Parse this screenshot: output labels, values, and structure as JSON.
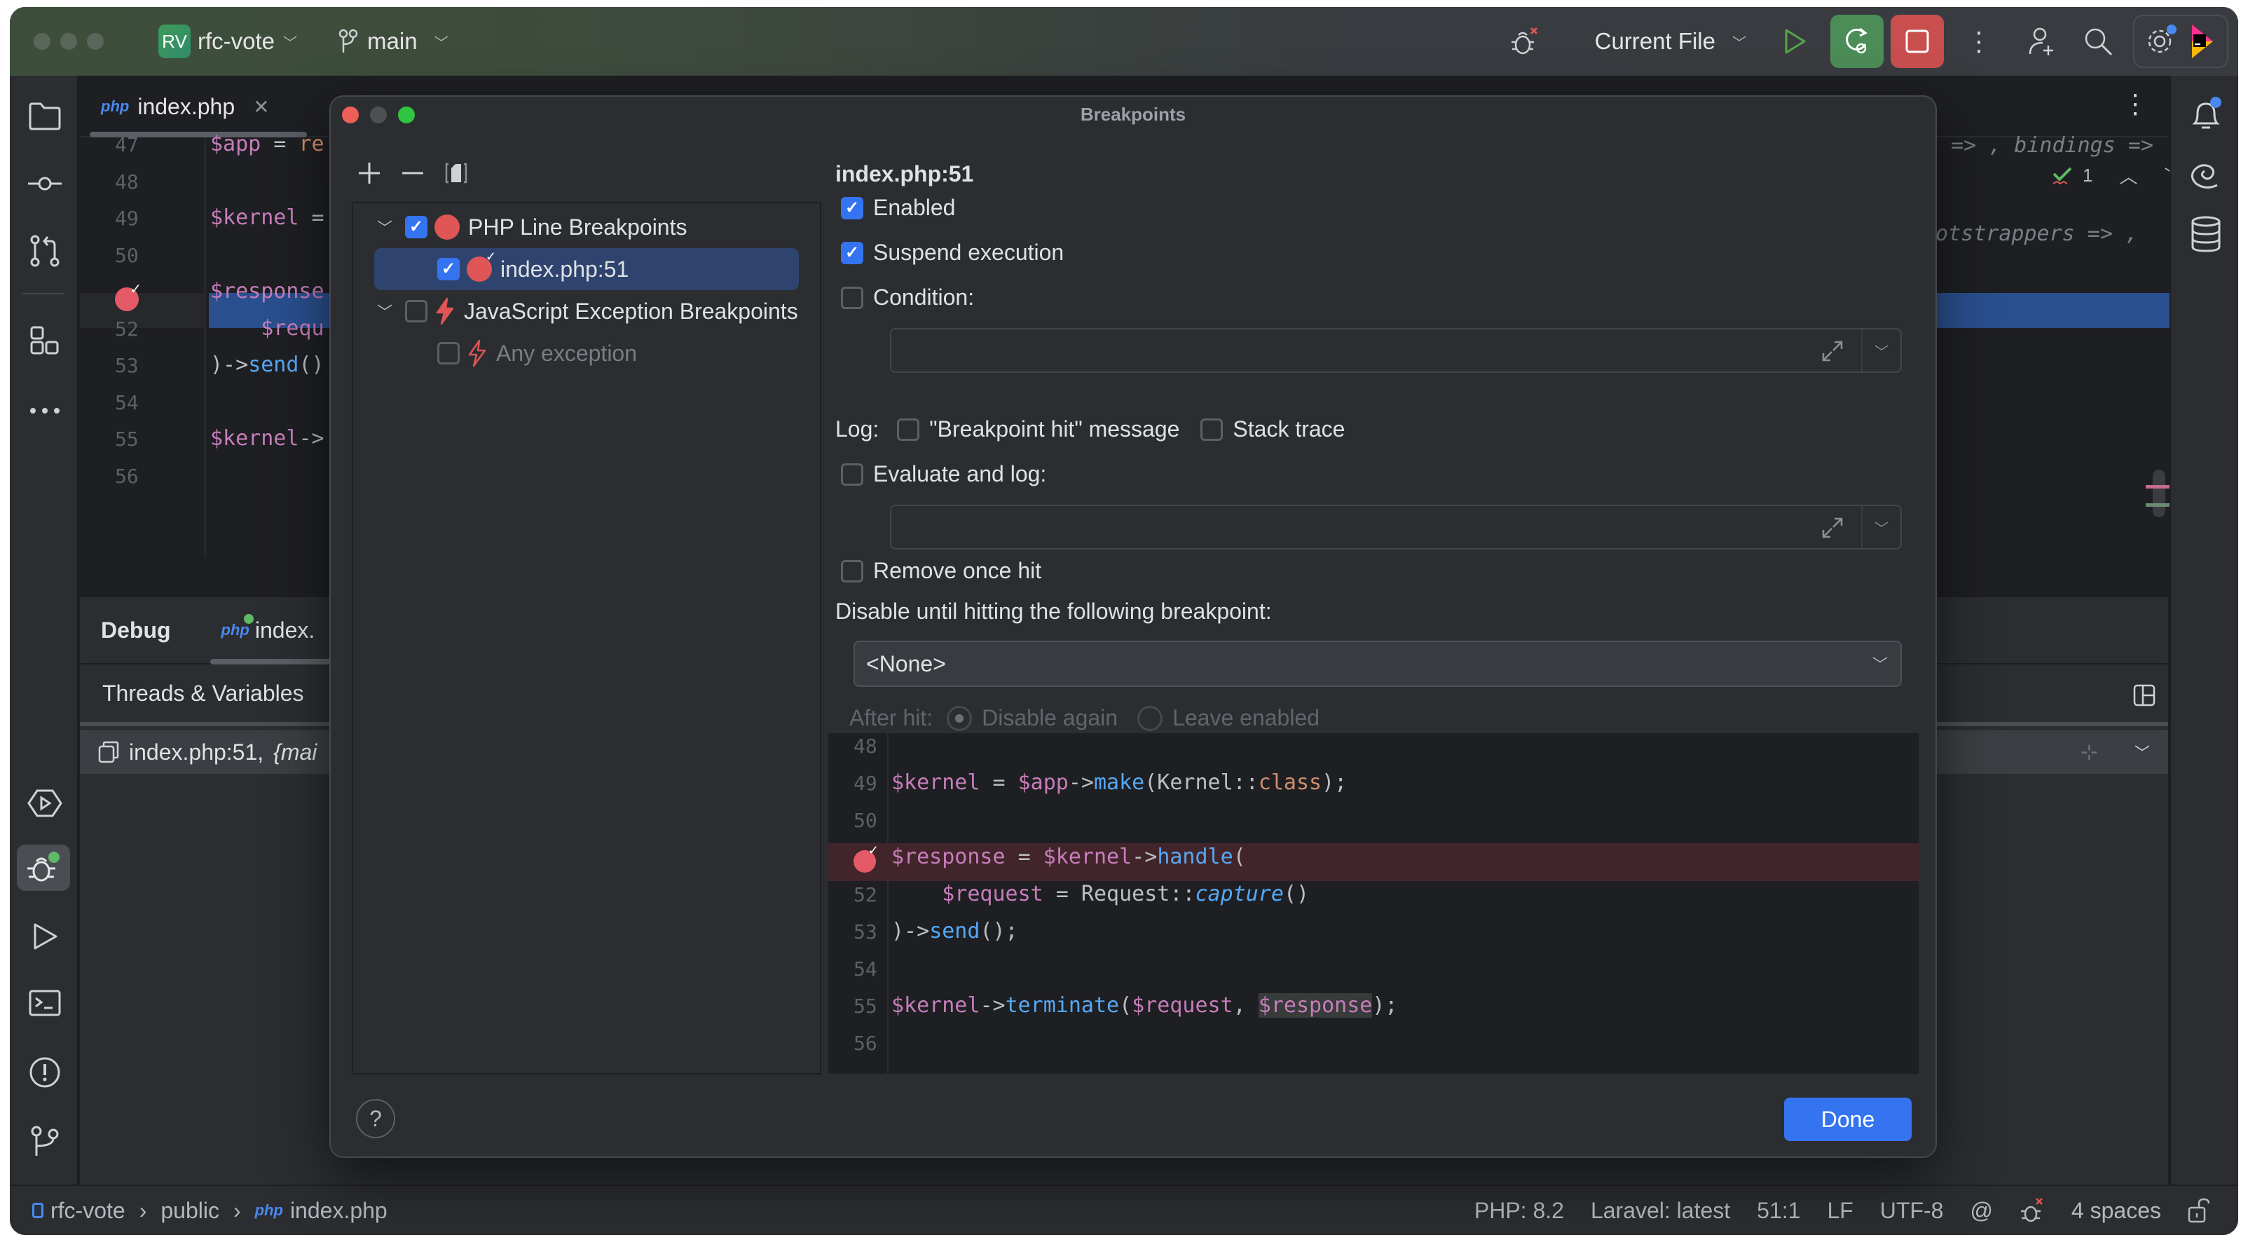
{
  "titlebar": {
    "project_badge": "RV",
    "project_name": "rfc-vote",
    "branch": "main",
    "run_config": "Current File"
  },
  "editor": {
    "tab_label": "index.php",
    "lines": [
      {
        "num": "47",
        "text": "$app = re"
      },
      {
        "num": "48",
        "text": ""
      },
      {
        "num": "49",
        "text": "$kernel ="
      },
      {
        "num": "50",
        "text": ""
      },
      {
        "num": "51",
        "text": "$response"
      },
      {
        "num": "52",
        "text": "    $requ"
      },
      {
        "num": "53",
        "text": ")->send()"
      },
      {
        "num": "54",
        "text": ""
      },
      {
        "num": "55",
        "text": "$kernel->"
      },
      {
        "num": "56",
        "text": ""
      }
    ],
    "inlay_hint_1": "=> , bindings =>",
    "inlay_hint_2": "ootstrappers => ,",
    "inspection_count": "1"
  },
  "debug_panel": {
    "title": "Debug",
    "session_tab": "index.",
    "subtab": "Threads & Variables",
    "frame": "index.php:51,",
    "frame_suffix": "{mai"
  },
  "statusbar": {
    "breadcrumb": [
      "rfc-vote",
      "public",
      "index.php"
    ],
    "php_version": "PHP: 8.2",
    "laravel": "Laravel: latest",
    "position": "51:1",
    "line_sep": "LF",
    "encoding": "UTF-8",
    "indent": "4 spaces"
  },
  "dialog": {
    "title": "Breakpoints",
    "tree": [
      {
        "label": "PHP Line Breakpoints",
        "checked": true,
        "level": 0,
        "type": "php-group"
      },
      {
        "label": "index.php:51",
        "checked": true,
        "level": 1,
        "type": "php-line",
        "selected": true
      },
      {
        "label": "JavaScript Exception Breakpoints",
        "checked": false,
        "level": 0,
        "type": "js-group"
      },
      {
        "label": "Any exception",
        "checked": false,
        "level": 1,
        "type": "js-exception",
        "disabled": true
      }
    ],
    "props": {
      "heading": "index.php:51",
      "enabled_label": "Enabled",
      "enabled": true,
      "suspend_label": "Suspend execution",
      "suspend": true,
      "condition_label": "Condition:",
      "condition": false,
      "condition_value": "",
      "log_label": "Log:",
      "log_message_label": "\"Breakpoint hit\" message",
      "log_message": false,
      "stack_trace_label": "Stack trace",
      "stack_trace": false,
      "evaluate_label": "Evaluate and log:",
      "evaluate": false,
      "evaluate_value": "",
      "remove_label": "Remove once hit",
      "remove": false,
      "disable_until_label": "Disable until hitting the following breakpoint:",
      "disable_until_value": "<None>",
      "after_hit_label": "After hit:",
      "after_hit_options": [
        "Disable again",
        "Leave enabled"
      ],
      "after_hit_selected": "Disable again"
    },
    "preview_lines": [
      {
        "num": "48",
        "html": ""
      },
      {
        "num": "49",
        "html": "<span class='v'>$kernel</span> = <span class='v'>$app</span>-&gt;<span class='fn'>make</span>(Kernel::<span class='kw'>class</span>);"
      },
      {
        "num": "50",
        "html": ""
      },
      {
        "num": "51",
        "html": "<span class='v'>$response</span> = <span class='v'>$kernel</span>-&gt;<span class='fn'>handle</span>(",
        "breakpoint": true
      },
      {
        "num": "52",
        "html": "    <span class='v'>$request</span> = Request::<span class='fn' style='font-style:italic'>capture</span>()"
      },
      {
        "num": "53",
        "html": ")-&gt;<span class='fn'>send</span>();"
      },
      {
        "num": "54",
        "html": ""
      },
      {
        "num": "55",
        "html": "<span class='v'>$kernel</span>-&gt;<span class='fn'>terminate</span>(<span class='v'>$request</span>, <span class='v' style='background:#373b39'>$response</span>);"
      },
      {
        "num": "56",
        "html": ""
      }
    ],
    "help_label": "?",
    "done_label": "Done"
  },
  "colors": {
    "accent": "#3574f0",
    "breakpoint": "#e05555",
    "run_green": "#4c8c57",
    "stop_red": "#c94f4f"
  }
}
